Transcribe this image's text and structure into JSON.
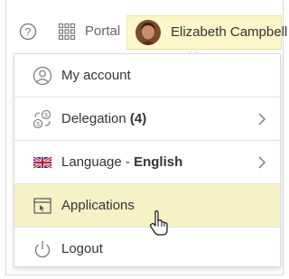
{
  "header": {
    "portal_label": "Portal",
    "user_name": "Elizabeth Campbell"
  },
  "menu": {
    "items": [
      {
        "label": "My account",
        "icon": "account-icon"
      },
      {
        "label": "Delegation ",
        "count": "(4)",
        "icon": "delegation-icon",
        "has_submenu": true
      },
      {
        "label": "Language - ",
        "value": "English",
        "icon": "uk-flag-icon",
        "has_submenu": true
      },
      {
        "label": "Applications",
        "icon": "applications-icon",
        "highlighted": true
      },
      {
        "label": "Logout",
        "icon": "power-icon"
      }
    ]
  },
  "colors": {
    "highlight": "#f7f1c6",
    "chip_background": "#fdf6c9"
  }
}
